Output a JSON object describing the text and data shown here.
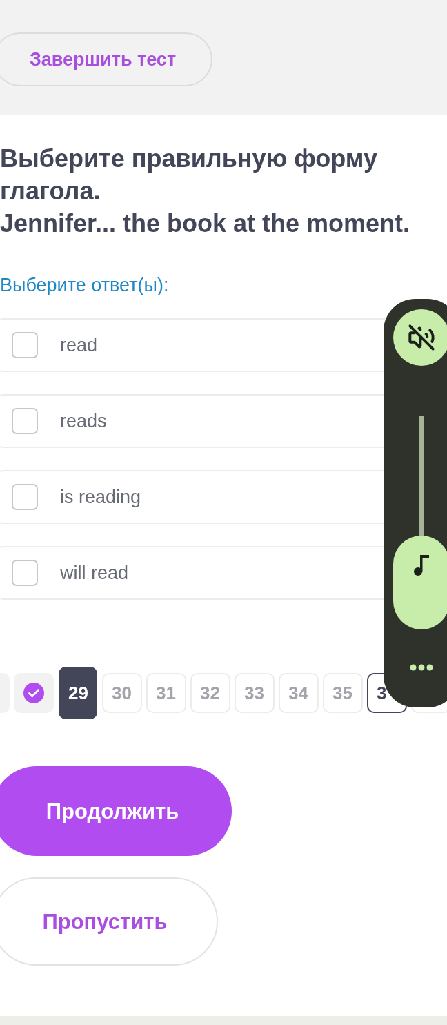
{
  "header": {
    "finish_button": "Завершить тест"
  },
  "question": {
    "prompt": "Выберите правильную форму глагола.",
    "sentence": "Jennifer... the book at the moment."
  },
  "answer_hint": "Выберите ответ(ы):",
  "options": [
    {
      "label": "read",
      "checked": false
    },
    {
      "label": "reads",
      "checked": false
    },
    {
      "label": "is reading",
      "checked": false
    },
    {
      "label": "will read",
      "checked": false
    }
  ],
  "pagination": [
    {
      "answered": true,
      "selected": false,
      "marked": false
    },
    {
      "answered": true,
      "selected": false,
      "marked": false
    },
    {
      "label": "29",
      "answered": false,
      "selected": true,
      "marked": false
    },
    {
      "label": "30",
      "answered": false,
      "selected": false,
      "marked": false
    },
    {
      "label": "31",
      "answered": false,
      "selected": false,
      "marked": false
    },
    {
      "label": "32",
      "answered": false,
      "selected": false,
      "marked": false
    },
    {
      "label": "33",
      "answered": false,
      "selected": false,
      "marked": false
    },
    {
      "label": "34",
      "answered": false,
      "selected": false,
      "marked": false
    },
    {
      "label": "35",
      "answered": false,
      "selected": false,
      "marked": false
    },
    {
      "label": "3",
      "answered": false,
      "selected": false,
      "marked": true
    },
    {
      "answered": false,
      "selected": false,
      "marked": false
    }
  ],
  "actions": {
    "continue": "Продолжить",
    "skip": "Пропустить"
  },
  "volume_panel": {
    "muted": true,
    "level": 0.44
  }
}
